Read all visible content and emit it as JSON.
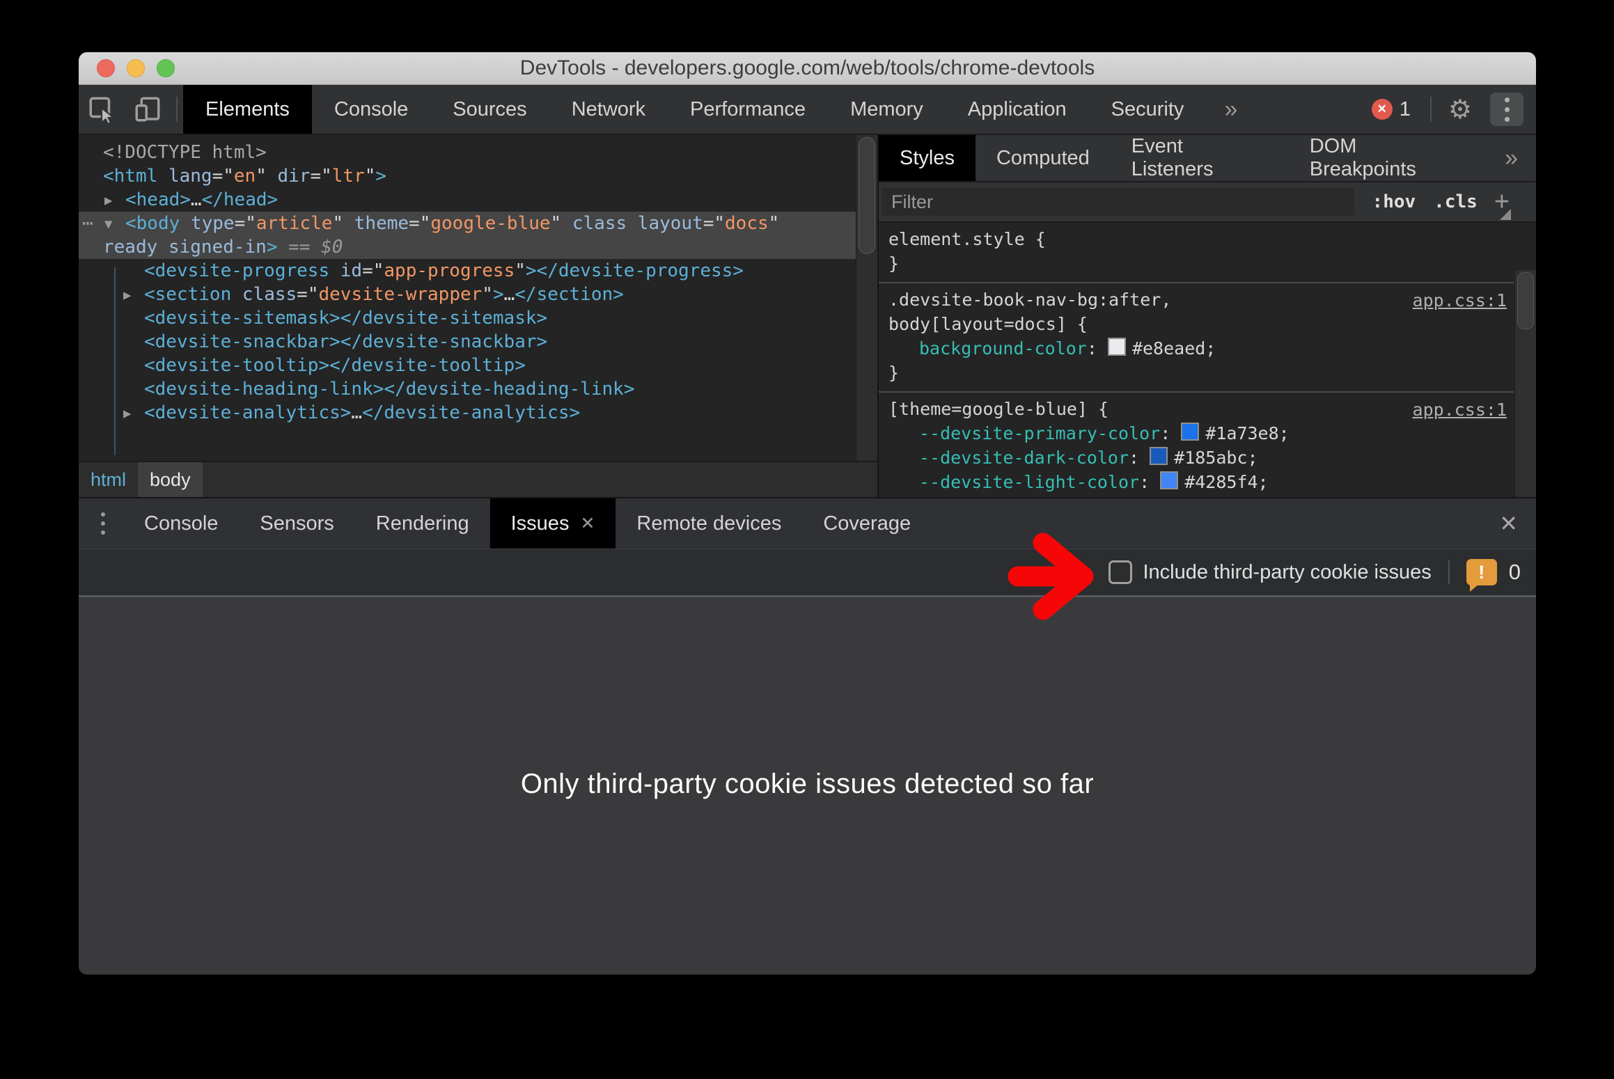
{
  "window": {
    "title": "DevTools - developers.google.com/web/tools/chrome-devtools"
  },
  "icons": {
    "gear": "⚙",
    "overflow_chevron": "»",
    "close_x": "✕",
    "more_dots": "⋯",
    "arrow_open": "▼",
    "arrow_closed": "▶",
    "plus": "+"
  },
  "colors": {
    "annotation_arrow_red": "#f60606",
    "warning_orange": "#e39b3b",
    "error_red": "#e25a4e",
    "tag_blue": "#5db0d7",
    "attr_blue": "#9bbbdc",
    "value_orange": "#f29766",
    "property_teal": "#35beb5",
    "selection_gray": "#454545"
  },
  "toolbar": {
    "tabs": [
      {
        "label": "Elements",
        "selected": true
      },
      {
        "label": "Console"
      },
      {
        "label": "Sources"
      },
      {
        "label": "Network"
      },
      {
        "label": "Performance"
      },
      {
        "label": "Memory"
      },
      {
        "label": "Application"
      },
      {
        "label": "Security"
      }
    ],
    "overflow": "»",
    "error_count": "1",
    "error_x": "✕"
  },
  "elements_panel": {
    "dom_lines": [
      {
        "indent": 0,
        "tokens": [
          [
            "doctype",
            "<!DOCTYPE html>"
          ]
        ]
      },
      {
        "indent": 0,
        "tokens": [
          [
            "tag",
            "<html"
          ],
          [
            "plain",
            " "
          ],
          [
            "attr",
            "lang"
          ],
          [
            "punc",
            "=\""
          ],
          [
            "val",
            "en"
          ],
          [
            "punc",
            "\""
          ],
          [
            "plain",
            " "
          ],
          [
            "attr",
            "dir"
          ],
          [
            "punc",
            "=\""
          ],
          [
            "val",
            "ltr"
          ],
          [
            "punc",
            "\""
          ],
          [
            "tag",
            ">"
          ]
        ]
      },
      {
        "indent": 1,
        "arrow": "closed",
        "tokens": [
          [
            "tag",
            "<head>"
          ],
          [
            "ellipsis",
            "…"
          ],
          [
            "tag",
            "</head>"
          ]
        ]
      },
      {
        "indent": 1,
        "arrow": "open",
        "dots": true,
        "selected": true,
        "tokens": [
          [
            "tag",
            "<body"
          ],
          [
            "plain",
            " "
          ],
          [
            "attr",
            "type"
          ],
          [
            "punc",
            "=\""
          ],
          [
            "val",
            "article"
          ],
          [
            "punc",
            "\""
          ],
          [
            "plain",
            " "
          ],
          [
            "attr",
            "theme"
          ],
          [
            "punc",
            "=\""
          ],
          [
            "val",
            "google-blue"
          ],
          [
            "punc",
            "\""
          ],
          [
            "plain",
            " "
          ],
          [
            "attr",
            "class"
          ],
          [
            "plain",
            " "
          ],
          [
            "attr",
            "layout"
          ],
          [
            "punc",
            "=\""
          ],
          [
            "val",
            "docs"
          ],
          [
            "punc",
            "\""
          ]
        ]
      },
      {
        "indent": 0,
        "selected": true,
        "tokens": [
          [
            "attr",
            "ready"
          ],
          [
            "plain",
            " "
          ],
          [
            "attr",
            "signed-in"
          ],
          [
            "tag",
            ">"
          ],
          [
            "dollar",
            " == $0"
          ]
        ]
      },
      {
        "indent": 2,
        "tokens": [
          [
            "tag",
            "<devsite-progress"
          ],
          [
            "plain",
            " "
          ],
          [
            "attr",
            "id"
          ],
          [
            "punc",
            "=\""
          ],
          [
            "val",
            "app-progress"
          ],
          [
            "punc",
            "\""
          ],
          [
            "tag",
            "></devsite-progress>"
          ]
        ]
      },
      {
        "indent": 2,
        "arrow": "closed",
        "tokens": [
          [
            "tag",
            "<section"
          ],
          [
            "plain",
            " "
          ],
          [
            "attr",
            "class"
          ],
          [
            "punc",
            "=\""
          ],
          [
            "val",
            "devsite-wrapper"
          ],
          [
            "punc",
            "\""
          ],
          [
            "tag",
            ">"
          ],
          [
            "ellipsis",
            "…"
          ],
          [
            "tag",
            "</section>"
          ]
        ]
      },
      {
        "indent": 2,
        "tokens": [
          [
            "tag",
            "<devsite-sitemask></devsite-sitemask>"
          ]
        ]
      },
      {
        "indent": 2,
        "tokens": [
          [
            "tag",
            "<devsite-snackbar></devsite-snackbar>"
          ]
        ]
      },
      {
        "indent": 2,
        "tokens": [
          [
            "tag",
            "<devsite-tooltip></devsite-tooltip>"
          ]
        ]
      },
      {
        "indent": 2,
        "tokens": [
          [
            "tag",
            "<devsite-heading-link></devsite-heading-link>"
          ]
        ]
      },
      {
        "indent": 2,
        "arrow": "closed",
        "tokens": [
          [
            "tag",
            "<devsite-analytics>"
          ],
          [
            "ellipsis",
            "…"
          ],
          [
            "tag",
            "</devsite-analytics>"
          ]
        ]
      }
    ],
    "breadcrumbs": [
      {
        "label": "html",
        "active": false
      },
      {
        "label": "body",
        "active": true
      }
    ]
  },
  "styles_panel": {
    "tabs": [
      {
        "label": "Styles",
        "selected": true
      },
      {
        "label": "Computed"
      },
      {
        "label": "Event Listeners"
      },
      {
        "label": "DOM Breakpoints"
      }
    ],
    "overflow": "»",
    "filter_placeholder": "Filter",
    "hov_label": ":hov",
    "cls_label": ".cls",
    "plus_label": "+",
    "rules": [
      {
        "link": null,
        "lines": [
          {
            "tokens": [
              [
                "sel",
                "element.style"
              ],
              [
                "plain",
                " {"
              ]
            ]
          },
          {
            "tokens": [
              [
                "plain",
                "}"
              ]
            ]
          }
        ]
      },
      {
        "link": "app.css:1",
        "lines": [
          {
            "tokens": [
              [
                "sel",
                ".devsite-book-nav-bg:after,"
              ]
            ]
          },
          {
            "tokens": [
              [
                "sel",
                "body[layout=docs]"
              ],
              [
                "plain",
                " {"
              ]
            ]
          },
          {
            "prop": true,
            "tokens": [
              [
                "prop",
                "background-color"
              ],
              [
                "plain",
                ": "
              ],
              [
                "swatch",
                "#e8eaed"
              ],
              [
                "plain",
                "#e8eaed;"
              ]
            ]
          },
          {
            "tokens": [
              [
                "plain",
                "}"
              ]
            ]
          }
        ]
      },
      {
        "link": "app.css:1",
        "lines": [
          {
            "tokens": [
              [
                "sel",
                "[theme=google-blue]"
              ],
              [
                "plain",
                " {"
              ]
            ]
          },
          {
            "prop": true,
            "tokens": [
              [
                "prop",
                "--devsite-primary-color"
              ],
              [
                "plain",
                ": "
              ],
              [
                "swatch",
                "#1a73e8"
              ],
              [
                "plain",
                "#1a73e8;"
              ]
            ]
          },
          {
            "prop": true,
            "tokens": [
              [
                "prop",
                "--devsite-dark-color"
              ],
              [
                "plain",
                ": "
              ],
              [
                "swatch",
                "#185abc"
              ],
              [
                "plain",
                "#185abc;"
              ]
            ]
          },
          {
            "prop": true,
            "tokens": [
              [
                "prop",
                "--devsite-light-color"
              ],
              [
                "plain",
                ": "
              ],
              [
                "swatch",
                "#4285f4"
              ],
              [
                "plain",
                "#4285f4;"
              ]
            ]
          }
        ]
      }
    ]
  },
  "drawer": {
    "tabs": [
      {
        "label": "Console"
      },
      {
        "label": "Sensors"
      },
      {
        "label": "Rendering"
      },
      {
        "label": "Issues",
        "selected": true,
        "closable": true
      },
      {
        "label": "Remote devices"
      },
      {
        "label": "Coverage"
      }
    ],
    "toolbar": {
      "checkbox_label": "Include third-party cookie issues",
      "checked": false,
      "issue_count": "0"
    },
    "message": "Only third-party cookie issues detected so far"
  }
}
